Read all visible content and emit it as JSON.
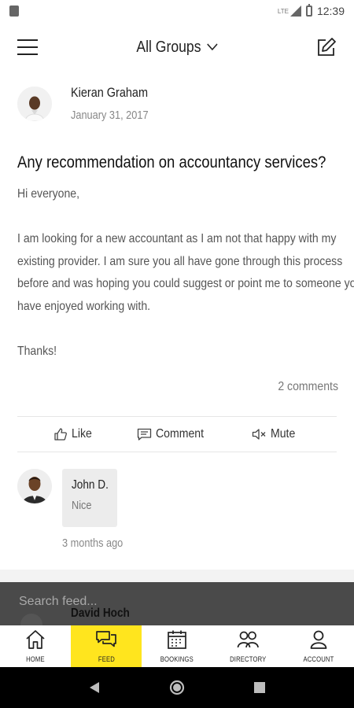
{
  "status_bar": {
    "network": "LTE",
    "time": "12:39"
  },
  "app_bar": {
    "title": "All Groups"
  },
  "post": {
    "author_name": "Kieran Graham",
    "date": "January 31, 2017",
    "title": "Any recommendation on accountancy services?",
    "body_lines": [
      "Hi everyone,",
      "I am looking for a new accountant as I am not that happy with my",
      "existing provider. I am sure you all have gone through this process",
      "before and was hoping you could suggest or point me to someone you",
      "have enjoyed working with.",
      "Thanks!"
    ],
    "comment_count": "2 comments"
  },
  "actions": {
    "like": "Like",
    "comment": "Comment",
    "mute": "Mute"
  },
  "comment": {
    "author": "John D.",
    "text": "Nice",
    "time": "3 months ago"
  },
  "search": {
    "placeholder": "Search feed..."
  },
  "next_post": {
    "author_name": "David Hoch"
  },
  "tabs": [
    {
      "label": "HOME",
      "icon": "home-icon"
    },
    {
      "label": "FEED",
      "icon": "chat-icon"
    },
    {
      "label": "BOOKINGS",
      "icon": "calendar-icon"
    },
    {
      "label": "DIRECTORY",
      "icon": "people-icon"
    },
    {
      "label": "ACCOUNT",
      "icon": "person-icon"
    }
  ],
  "active_tab": "FEED",
  "colors": {
    "accent": "#ffe51e",
    "overlay": "#4a4a4a"
  }
}
